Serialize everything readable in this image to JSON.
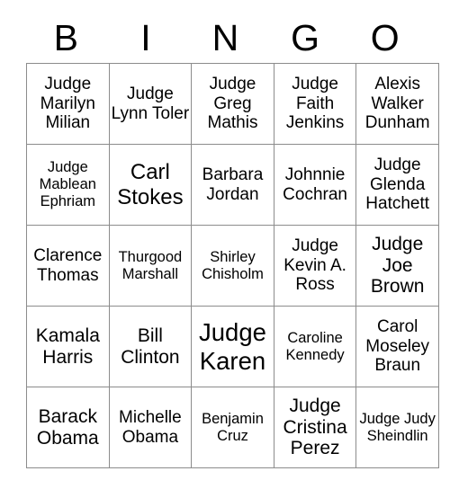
{
  "card": {
    "header": {
      "letters": [
        "B",
        "I",
        "N",
        "G",
        "O"
      ]
    },
    "rows": [
      [
        {
          "text": "Judge Marilyn Milian",
          "size": "fs-m"
        },
        {
          "text": "Judge Lynn Toler",
          "size": "fs-m"
        },
        {
          "text": "Judge Greg Mathis",
          "size": "fs-m"
        },
        {
          "text": "Judge Faith Jenkins",
          "size": "fs-m"
        },
        {
          "text": "Alexis Walker Dunham",
          "size": "fs-m"
        }
      ],
      [
        {
          "text": "Judge Mablean Ephriam",
          "size": "fs-s"
        },
        {
          "text": "Carl Stokes",
          "size": "fs-xl"
        },
        {
          "text": "Barbara Jordan",
          "size": "fs-m"
        },
        {
          "text": "Johnnie Cochran",
          "size": "fs-m"
        },
        {
          "text": "Judge Glenda Hatchett",
          "size": "fs-m"
        }
      ],
      [
        {
          "text": "Clarence Thomas",
          "size": "fs-m"
        },
        {
          "text": "Thurgood Marshall",
          "size": "fs-s"
        },
        {
          "text": "Shirley Chisholm",
          "size": "fs-s"
        },
        {
          "text": "Judge Kevin A. Ross",
          "size": "fs-m"
        },
        {
          "text": "Judge Joe Brown",
          "size": "fs-l"
        }
      ],
      [
        {
          "text": "Kamala Harris",
          "size": "fs-l"
        },
        {
          "text": "Bill Clinton",
          "size": "fs-l"
        },
        {
          "text": "Judge Karen",
          "size": "fs-xxl"
        },
        {
          "text": "Caroline Kennedy",
          "size": "fs-s"
        },
        {
          "text": "Carol Moseley Braun",
          "size": "fs-m"
        }
      ],
      [
        {
          "text": "Barack Obama",
          "size": "fs-l"
        },
        {
          "text": "Michelle Obama",
          "size": "fs-m"
        },
        {
          "text": "Benjamin Cruz",
          "size": "fs-s"
        },
        {
          "text": "Judge Cristina Perez",
          "size": "fs-l"
        },
        {
          "text": "Judge Judy Sheindlin",
          "size": "fs-s"
        }
      ]
    ]
  },
  "colors": {
    "background": "#ffffff",
    "text": "#000000",
    "grid_line": "#8c8c8c"
  }
}
